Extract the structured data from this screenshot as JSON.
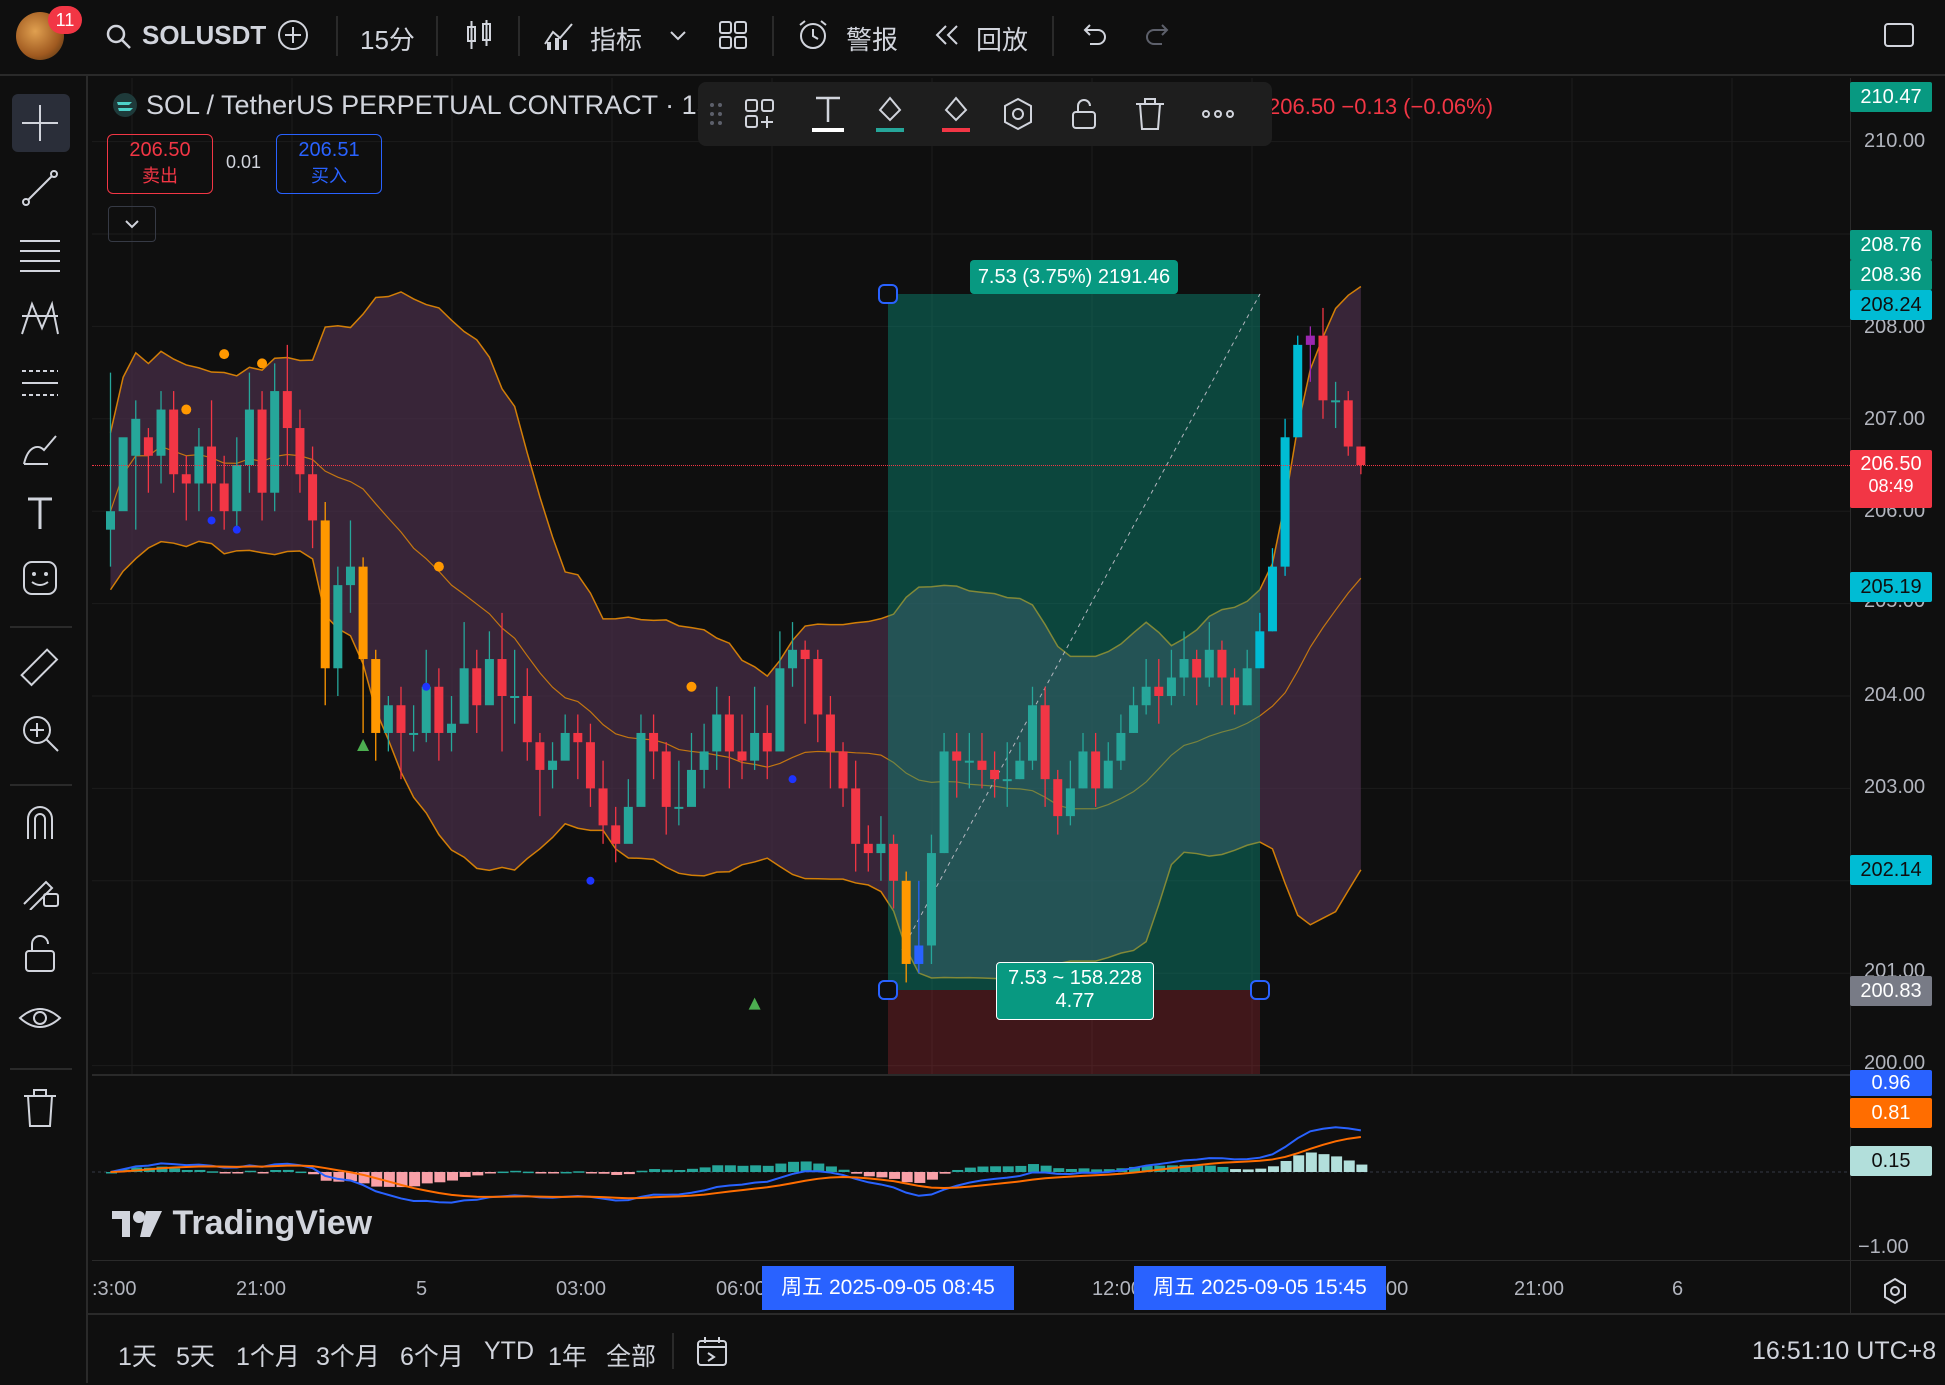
{
  "topbar": {
    "notification_count": "11",
    "symbol": "SOLUSDT",
    "interval": "15分",
    "indicators_label": "指标",
    "alert_label": "警报",
    "replay_label": "回放"
  },
  "legend": {
    "title": "SOL / TetherUS PERPETUAL CONTRACT · 15 ·",
    "change_text": "206.50 −0.13 (−0.06%)",
    "sell_price": "206.50",
    "sell_label": "卖出",
    "spread": "0.01",
    "buy_price": "206.51",
    "buy_label": "买入"
  },
  "position_tool": {
    "profit_label": "7.53 (3.75%) 2191.46",
    "info_line1": "7.53 ~ 158.228",
    "info_line2": "4.77"
  },
  "price_scale": {
    "labels": [
      "210.00",
      "208.00",
      "207.00",
      "206.00",
      "205.00",
      "204.00",
      "203.00",
      "202.00",
      "201.00",
      "200.00"
    ],
    "tags": {
      "top": "210.47",
      "t1": "208.76",
      "t2": "208.36",
      "t3": "208.24",
      "last": "206.50",
      "countdown": "08:49",
      "t5": "205.19",
      "t6": "202.14",
      "t7": "200.83"
    },
    "macd_labels": {
      "macd": "0.96",
      "signal": "0.81",
      "hist": "0.15",
      "neg": "−1.00"
    }
  },
  "time_scale": {
    "labels": [
      ":3:00",
      "21:00",
      "5",
      "03:00",
      "06:00",
      "12:00",
      "00",
      "21:00",
      "6"
    ],
    "start_tag": "周五 2025-09-05   08:45",
    "end_tag": "周五 2025-09-05   15:45"
  },
  "watermark": "TradingView",
  "bottombar": {
    "ranges": [
      "1天",
      "5天",
      "1个月",
      "3个月",
      "6个月",
      "YTD",
      "1年",
      "全部"
    ],
    "clock": "16:51:10 UTC+8"
  },
  "colors": {
    "up": "#26a69a",
    "down": "#f23645",
    "orange": "#ff9800",
    "cyan": "#00bcd4",
    "blue": "#2962ff",
    "purple": "#9c27b0",
    "band": "#4a2f4a"
  },
  "chart_data": {
    "type": "candlestick",
    "ylim": [
      199.9,
      210.6
    ],
    "candles": [
      [
        205.8,
        206.0,
        205.4,
        207.5
      ],
      [
        206.0,
        206.8,
        206.5,
        206.6
      ],
      [
        206.6,
        207.0,
        205.8,
        207.2
      ],
      [
        206.8,
        206.6,
        206.2,
        206.9
      ],
      [
        206.6,
        207.1,
        206.3,
        207.3
      ],
      [
        207.1,
        206.4,
        206.2,
        207.3
      ],
      [
        206.4,
        206.3,
        205.9,
        206.6
      ],
      [
        206.3,
        206.7,
        206.0,
        206.9
      ],
      [
        206.7,
        206.3,
        206.0,
        207.2
      ],
      [
        206.3,
        206.0,
        205.8,
        206.6
      ],
      [
        206.0,
        206.5,
        205.8,
        206.8
      ],
      [
        206.5,
        207.1,
        206.2,
        207.5
      ],
      [
        207.1,
        206.2,
        205.9,
        207.3
      ],
      [
        206.2,
        207.3,
        206.0,
        207.6
      ],
      [
        207.3,
        206.9,
        206.5,
        207.8
      ],
      [
        206.9,
        206.4,
        206.2,
        207.1
      ],
      [
        206.4,
        205.9,
        205.6,
        206.7
      ],
      [
        205.9,
        204.3,
        203.9,
        206.1
      ],
      [
        204.3,
        205.2,
        204.0,
        205.4
      ],
      [
        205.2,
        205.4,
        204.9,
        205.9
      ],
      [
        205.4,
        204.4,
        203.6,
        205.5
      ],
      [
        204.4,
        203.6,
        203.3,
        204.5
      ],
      [
        203.6,
        203.9,
        203.4,
        204.0
      ],
      [
        203.9,
        203.6,
        203.1,
        204.1
      ],
      [
        203.6,
        203.6,
        203.4,
        203.9
      ],
      [
        203.6,
        204.1,
        203.5,
        204.5
      ],
      [
        204.1,
        203.6,
        203.3,
        204.3
      ],
      [
        203.6,
        203.7,
        203.4,
        204.0
      ],
      [
        203.7,
        204.3,
        203.9,
        204.8
      ],
      [
        204.3,
        203.9,
        203.6,
        204.5
      ],
      [
        203.9,
        204.4,
        204.0,
        204.7
      ],
      [
        204.4,
        204.0,
        203.4,
        204.9
      ],
      [
        204.0,
        204.0,
        203.7,
        204.5
      ],
      [
        204.0,
        203.5,
        203.3,
        204.3
      ],
      [
        203.5,
        203.2,
        202.7,
        203.6
      ],
      [
        203.2,
        203.3,
        203.0,
        203.5
      ],
      [
        203.3,
        203.6,
        203.4,
        203.8
      ],
      [
        203.6,
        203.5,
        203.1,
        203.8
      ],
      [
        203.5,
        203.0,
        202.8,
        203.7
      ],
      [
        203.0,
        202.6,
        202.4,
        203.3
      ],
      [
        202.6,
        202.4,
        202.2,
        202.8
      ],
      [
        202.4,
        202.8,
        202.5,
        203.1
      ],
      [
        202.8,
        203.6,
        203.0,
        203.8
      ],
      [
        203.6,
        203.4,
        203.1,
        203.8
      ],
      [
        203.4,
        202.8,
        202.5,
        203.5
      ],
      [
        202.8,
        202.8,
        202.6,
        203.3
      ],
      [
        202.8,
        203.2,
        202.9,
        203.6
      ],
      [
        203.2,
        203.4,
        203.0,
        203.7
      ],
      [
        203.4,
        203.8,
        203.2,
        204.1
      ],
      [
        203.8,
        203.4,
        203.0,
        204.0
      ],
      [
        203.4,
        203.3,
        203.1,
        203.8
      ],
      [
        203.3,
        203.6,
        203.2,
        204.1
      ],
      [
        203.6,
        203.4,
        203.1,
        203.9
      ],
      [
        203.4,
        204.3,
        203.6,
        204.7
      ],
      [
        204.3,
        204.5,
        204.1,
        204.8
      ],
      [
        204.5,
        204.4,
        203.7,
        204.6
      ],
      [
        204.4,
        203.8,
        203.5,
        204.5
      ],
      [
        203.8,
        203.4,
        203.0,
        204.0
      ],
      [
        203.4,
        203.0,
        202.8,
        203.5
      ],
      [
        203.0,
        202.4,
        202.1,
        203.3
      ],
      [
        202.4,
        202.3,
        202.1,
        202.6
      ],
      [
        202.3,
        202.4,
        202.0,
        202.7
      ],
      [
        202.4,
        202.0,
        201.7,
        202.5
      ],
      [
        202.0,
        201.1,
        200.9,
        202.1
      ],
      [
        201.1,
        201.3,
        201.0,
        202.0
      ],
      [
        201.3,
        202.3,
        201.1,
        202.5
      ],
      [
        202.3,
        203.4,
        202.3,
        203.6
      ],
      [
        203.4,
        203.3,
        202.9,
        203.6
      ],
      [
        203.3,
        203.3,
        203.0,
        203.6
      ],
      [
        203.3,
        203.2,
        203.0,
        203.6
      ],
      [
        203.2,
        203.1,
        202.9,
        203.4
      ],
      [
        203.1,
        203.1,
        202.8,
        203.5
      ],
      [
        203.1,
        203.3,
        203.1,
        203.5
      ],
      [
        203.3,
        203.9,
        203.2,
        204.1
      ],
      [
        203.9,
        203.1,
        202.8,
        204.1
      ],
      [
        203.1,
        202.7,
        202.5,
        203.2
      ],
      [
        202.7,
        203.0,
        202.6,
        203.3
      ],
      [
        203.0,
        203.4,
        203.0,
        203.6
      ],
      [
        203.4,
        203.0,
        202.8,
        203.6
      ],
      [
        203.0,
        203.3,
        203.0,
        203.5
      ],
      [
        203.3,
        203.6,
        203.2,
        203.8
      ],
      [
        203.6,
        203.9,
        203.6,
        204.1
      ],
      [
        203.9,
        204.1,
        203.8,
        204.4
      ],
      [
        204.1,
        204.0,
        203.7,
        204.4
      ],
      [
        204.0,
        204.2,
        203.9,
        204.5
      ],
      [
        204.2,
        204.4,
        204.0,
        204.7
      ],
      [
        204.4,
        204.2,
        203.9,
        204.5
      ],
      [
        204.2,
        204.5,
        204.1,
        204.8
      ],
      [
        204.5,
        204.2,
        203.9,
        204.6
      ],
      [
        204.2,
        203.9,
        203.8,
        204.3
      ],
      [
        203.9,
        204.3,
        203.9,
        204.5
      ],
      [
        204.3,
        204.7,
        204.4,
        204.9
      ],
      [
        204.7,
        205.4,
        204.7,
        205.6
      ],
      [
        205.4,
        206.8,
        205.3,
        207.0
      ],
      [
        206.8,
        207.8,
        206.8,
        207.9
      ],
      [
        207.8,
        207.9,
        207.4,
        208.0
      ],
      [
        207.9,
        207.2,
        207.0,
        208.2
      ],
      [
        207.2,
        207.2,
        206.9,
        207.4
      ],
      [
        207.2,
        206.7,
        206.6,
        207.3
      ],
      [
        206.7,
        206.5,
        206.4,
        206.7
      ]
    ]
  }
}
